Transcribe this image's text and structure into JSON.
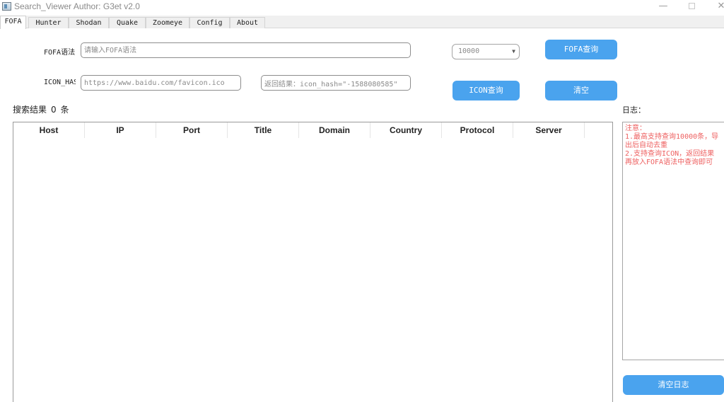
{
  "window": {
    "title": "Search_Viewer    Author: G3et    v2.0",
    "controls": {
      "minimize": "—",
      "close": "✕"
    }
  },
  "tabs": [
    "FOFA",
    "Hunter",
    "Shodan",
    "Quake",
    "Zoomeye",
    "Config",
    "About"
  ],
  "active_tab": "FOFA",
  "form": {
    "fofa_label": "FOFA语法",
    "fofa_placeholder": "请输入FOFA语法",
    "icon_label": "ICON_HASH",
    "icon_url_value": "https://www.baidu.com/favicon.ico",
    "icon_result_value": "返回结果：icon_hash=\"-1588080585\"",
    "limit_select": "10000",
    "fofa_query_button": "FOFA查询",
    "icon_query_button": "ICON查询",
    "clear_button": "清空"
  },
  "results": {
    "label": "搜索结果",
    "count": "0",
    "unit": "条",
    "columns": [
      "Host",
      "IP",
      "Port",
      "Title",
      "Domain",
      "Country",
      "Protocol",
      "Server"
    ],
    "rows": []
  },
  "log": {
    "label": "日志：",
    "lines": [
      "注意：",
      "1.最高支持查询10000条，导",
      "出后自动去重",
      "2.支持查询ICON，返回结果",
      "再放入FOFA语法中查询即可"
    ],
    "text_color": "#ee6060",
    "clear_button": "清空日志"
  },
  "colors": {
    "accent": "#4aa3ee",
    "log_text": "#ee6060"
  }
}
